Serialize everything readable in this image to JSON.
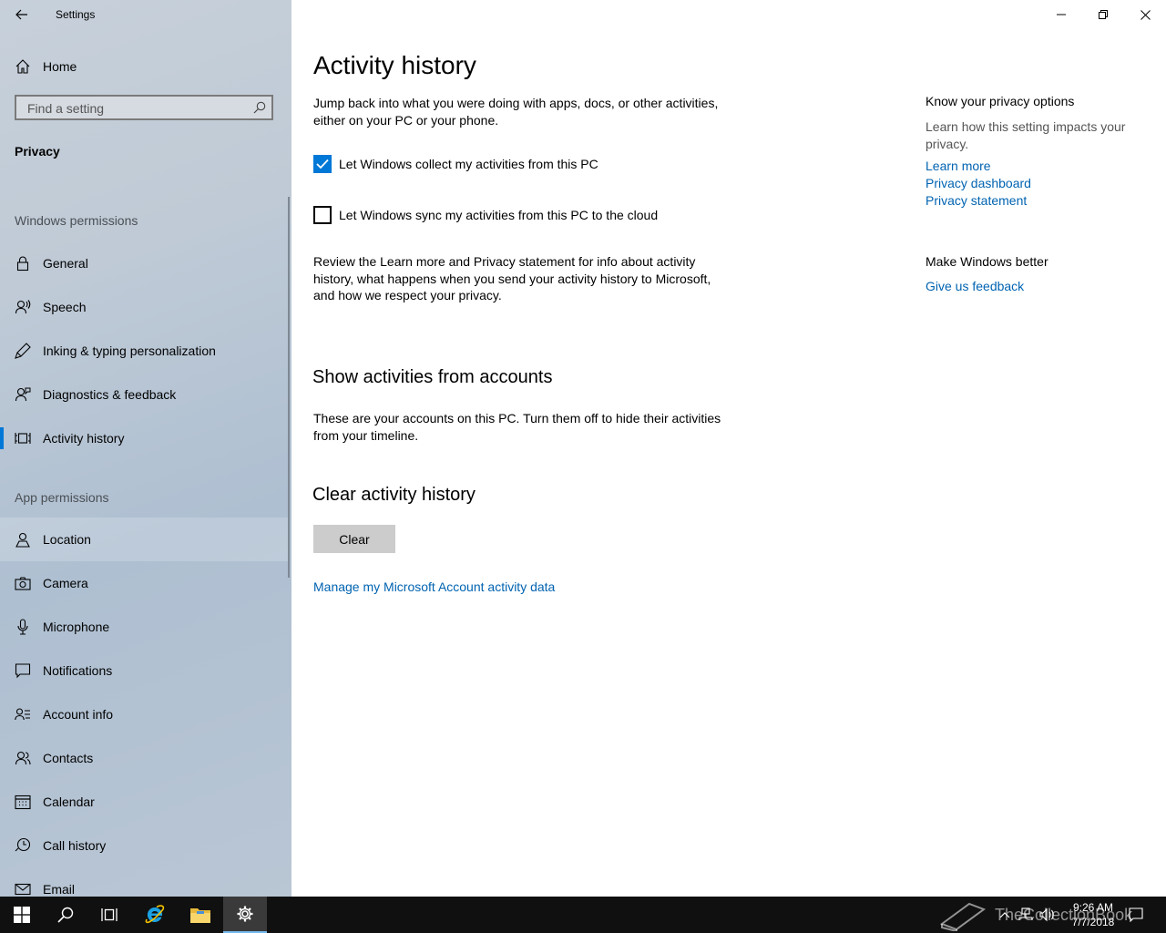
{
  "window": {
    "title": "Settings"
  },
  "sidebar": {
    "home_label": "Home",
    "search_placeholder": "Find a setting",
    "section_title": "Privacy",
    "windows_permissions_heading": "Windows permissions",
    "windows_permissions": [
      {
        "label": "General",
        "icon": "lock-icon"
      },
      {
        "label": "Speech",
        "icon": "speech-icon"
      },
      {
        "label": "Inking & typing personalization",
        "icon": "inking-icon"
      },
      {
        "label": "Diagnostics & feedback",
        "icon": "diagnostics-icon"
      },
      {
        "label": "Activity history",
        "icon": "activity-history-icon",
        "active": true
      }
    ],
    "app_permissions_heading": "App permissions",
    "app_permissions": [
      {
        "label": "Location",
        "icon": "location-icon"
      },
      {
        "label": "Camera",
        "icon": "camera-icon"
      },
      {
        "label": "Microphone",
        "icon": "microphone-icon"
      },
      {
        "label": "Notifications",
        "icon": "notifications-icon"
      },
      {
        "label": "Account info",
        "icon": "account-info-icon"
      },
      {
        "label": "Contacts",
        "icon": "contacts-icon"
      },
      {
        "label": "Calendar",
        "icon": "calendar-icon"
      },
      {
        "label": "Call history",
        "icon": "call-history-icon"
      },
      {
        "label": "Email",
        "icon": "email-icon"
      }
    ]
  },
  "main": {
    "title": "Activity history",
    "intro": "Jump back into what you were doing with apps, docs, or other activities, either on your PC or your phone.",
    "check_collect": {
      "label": "Let Windows collect my activities from this PC",
      "checked": true
    },
    "check_sync": {
      "label": "Let Windows sync my activities from this PC to the cloud",
      "checked": false
    },
    "review_text": "Review the Learn more and Privacy statement for info about activity history, what happens when you send your activity history to Microsoft, and how we respect your privacy.",
    "accounts_heading": "Show activities from accounts",
    "accounts_text": "These are your accounts on this PC. Turn them off to hide their activities from your timeline.",
    "clear_heading": "Clear activity history",
    "clear_button": "Clear",
    "manage_link": "Manage my Microsoft Account activity data"
  },
  "side_panel": {
    "privacy_heading": "Know your privacy options",
    "privacy_text": "Learn how this setting impacts your privacy.",
    "links": [
      "Learn more",
      "Privacy dashboard",
      "Privacy statement"
    ],
    "better_heading": "Make Windows better",
    "feedback_link": "Give us feedback"
  },
  "taskbar": {
    "time": "9:26 AM",
    "date": "7/7/2018",
    "watermark": "TheCollectionBook"
  },
  "colors": {
    "accent": "#0078d7",
    "link": "#0063b1",
    "taskbar": "#101010"
  }
}
